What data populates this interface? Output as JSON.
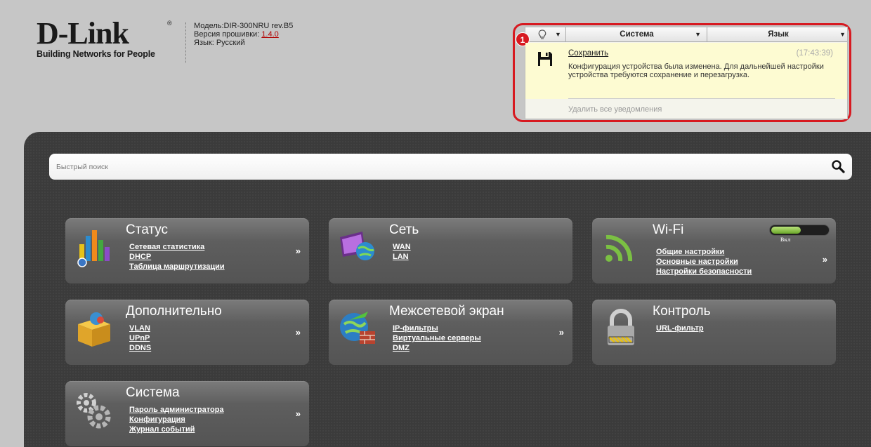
{
  "header": {
    "logo_text": "D-Link",
    "logo_reg": "®",
    "logo_tagline": "Building Networks for People",
    "model": "Модель:DIR-300NRU rev.B5",
    "firmware_label": "Версия прошивки: ",
    "firmware_version": "1.4.0",
    "language": "Язык: Русский"
  },
  "notifications": {
    "badge_count": "1",
    "menu_system": "Система",
    "menu_language": "Язык",
    "item": {
      "title": "Сохранить",
      "time": "(17:43:39)",
      "message": "Конфигурация устройства была изменена. Для дальнейшей настройки устройства требуются сохранение и перезагрузка."
    },
    "clear_all": "Удалить все уведомления",
    "highlight_color": "#d71920"
  },
  "search": {
    "placeholder": "Быстрый поиск"
  },
  "cards": {
    "status": {
      "title": "Статус",
      "links": [
        "Сетевая статистика",
        "DHCP",
        "Таблица маршрутизации"
      ],
      "arrow": "»"
    },
    "network": {
      "title": "Сеть",
      "links": [
        "WAN",
        "LAN"
      ]
    },
    "wifi": {
      "title": "Wi-Fi",
      "toggle_label": "Вкл",
      "toggle_on": true,
      "links": [
        "Общие настройки",
        "Основные настройки",
        "Настройки безопасности"
      ],
      "arrow": "»"
    },
    "advanced": {
      "title": "Дополнительно",
      "links": [
        "VLAN",
        "UPnP",
        "DDNS"
      ],
      "arrow": "»"
    },
    "firewall": {
      "title": "Межсетевой экран",
      "links": [
        "IP-фильтры",
        "Виртуальные серверы",
        "DMZ"
      ],
      "arrow": "»"
    },
    "control": {
      "title": "Контроль",
      "links": [
        "URL-фильтр"
      ]
    },
    "system": {
      "title": "Система",
      "links": [
        "Пароль администратора",
        "Конфигурация",
        "Журнал событий"
      ],
      "arrow": "»"
    }
  },
  "colors": {
    "background": "#c6c6c6",
    "panel": "#3b3b3b",
    "card": "#5e5e5e",
    "notif_body": "#fdfbd2",
    "toggle_green": "#8cc63f"
  }
}
